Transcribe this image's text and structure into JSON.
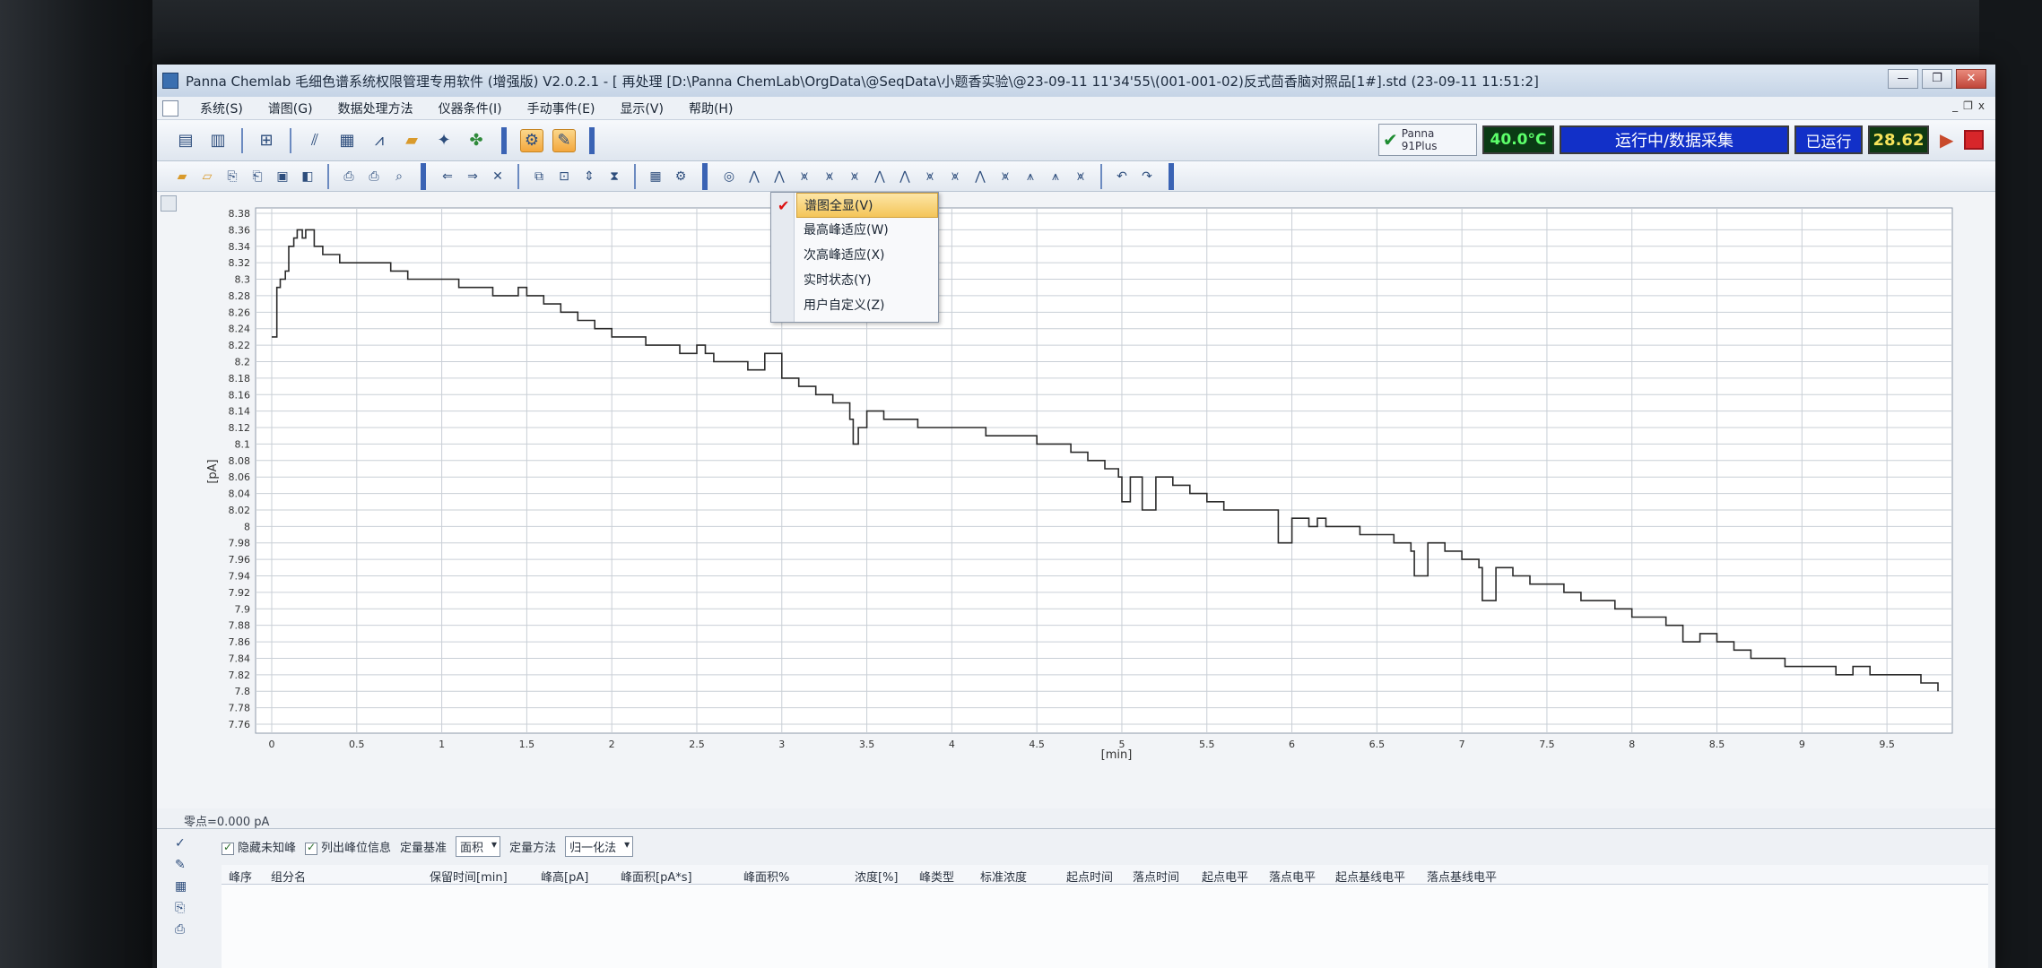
{
  "window": {
    "title": "Panna Chemlab 毛细色谱系统权限管理专用软件 (增强版) V2.0.2.1 - [ 再处理 [D:\\Panna ChemLab\\OrgData\\@SeqData\\小题香实验\\@23-09-11 11'34'55\\(001-001-02)反式茴香脑对照品[1#].std (23-09-11 11:51:2]",
    "buttons": {
      "minimize": "—",
      "restore": "❐",
      "close": "✕"
    }
  },
  "menubar": {
    "items": [
      "系统(S)",
      "谱图(G)",
      "数据处理方法",
      "仪器条件(I)",
      "手动事件(E)",
      "显示(V)",
      "帮助(H)"
    ],
    "mdi_buttons": [
      "_",
      "❐",
      "x"
    ]
  },
  "toolbar1": {
    "icons": [
      "method-icon",
      "report-icon",
      "grid-icon",
      "chart-icon",
      "table-icon",
      "compare-icon",
      "folder-icon",
      "network-icon",
      "tree-icon",
      "sequence-icon",
      "sample-icon"
    ]
  },
  "status": {
    "instrument_name": "Panna",
    "instrument_model": "91Plus",
    "temperature": "40.0°C",
    "run_state": "运行中/数据采集",
    "run_label": "已运行",
    "run_time": "28.62",
    "colors": {
      "temp_bg": "#0a3b14",
      "temp_fg": "#5cff6a",
      "state_bg": "#1230c8",
      "time_fg": "#f6e35a",
      "stop": "#d7262a"
    }
  },
  "dropdown": {
    "items": [
      {
        "label": "谱图全显(V)",
        "checked": true,
        "active": true
      },
      {
        "label": "最高峰适应(W)",
        "checked": false,
        "active": false
      },
      {
        "label": "次高峰适应(X)",
        "checked": false,
        "active": false
      },
      {
        "label": "实时状态(Y)",
        "checked": false,
        "active": false
      },
      {
        "label": "用户自定义(Z)",
        "checked": false,
        "active": false
      }
    ]
  },
  "chart_data": {
    "type": "line",
    "xlabel": "[min]",
    "ylabel": "[pA]",
    "xlim": [
      0,
      9.8
    ],
    "ylim": [
      7.76,
      8.38
    ],
    "x_ticks": [
      "0",
      "0.5",
      "1",
      "1.5",
      "2",
      "2.5",
      "3",
      "3.5",
      "4",
      "4.5",
      "5",
      "5.5",
      "6",
      "6.5",
      "7",
      "7.5",
      "8",
      "8.5",
      "9",
      "9.5"
    ],
    "y_ticks": [
      "8.38",
      "8.36",
      "8.34",
      "8.32",
      "8.3",
      "8.28",
      "8.26",
      "8.24",
      "8.22",
      "8.2",
      "8.18",
      "8.16",
      "8.14",
      "8.12",
      "8.1",
      "8.08",
      "8.06",
      "8.04",
      "8.02",
      "8",
      "7.98",
      "7.96",
      "7.94",
      "7.92",
      "7.9",
      "7.88",
      "7.86",
      "7.84",
      "7.82",
      "7.8",
      "7.78",
      "7.76"
    ],
    "grid": true,
    "series": [
      {
        "x": [
          0,
          0.03,
          0.05,
          0.08,
          0.1,
          0.13,
          0.15,
          0.18,
          0.2,
          0.25,
          0.3,
          0.35,
          0.4,
          0.5,
          0.6,
          0.7,
          0.8,
          0.9,
          1.0,
          1.1,
          1.2,
          1.3,
          1.4,
          1.45,
          1.5,
          1.6,
          1.7,
          1.8,
          1.9,
          2.0,
          2.1,
          2.2,
          2.3,
          2.4,
          2.5,
          2.55,
          2.6,
          2.7,
          2.8,
          2.9,
          3.0,
          3.1,
          3.2,
          3.3,
          3.4,
          3.42,
          3.45,
          3.5,
          3.6,
          3.7,
          3.8,
          3.9,
          4.0,
          4.1,
          4.2,
          4.3,
          4.4,
          4.5,
          4.6,
          4.7,
          4.8,
          4.9,
          4.98,
          5.0,
          5.05,
          5.1,
          5.12,
          5.2,
          5.3,
          5.4,
          5.5,
          5.6,
          5.7,
          5.8,
          5.9,
          5.92,
          6.0,
          6.1,
          6.15,
          6.2,
          6.3,
          6.4,
          6.5,
          6.6,
          6.7,
          6.72,
          6.8,
          6.9,
          7.0,
          7.1,
          7.12,
          7.2,
          7.3,
          7.4,
          7.5,
          7.6,
          7.7,
          7.8,
          7.9,
          8.0,
          8.1,
          8.2,
          8.3,
          8.4,
          8.5,
          8.6,
          8.7,
          8.8,
          8.9,
          9.0,
          9.1,
          9.2,
          9.3,
          9.4,
          9.5,
          9.6,
          9.7,
          9.8
        ],
        "y": [
          8.23,
          8.29,
          8.3,
          8.31,
          8.34,
          8.35,
          8.36,
          8.35,
          8.36,
          8.34,
          8.33,
          8.33,
          8.32,
          8.32,
          8.32,
          8.31,
          8.3,
          8.3,
          8.3,
          8.29,
          8.29,
          8.28,
          8.28,
          8.29,
          8.28,
          8.27,
          8.26,
          8.25,
          8.24,
          8.23,
          8.23,
          8.22,
          8.22,
          8.21,
          8.22,
          8.21,
          8.2,
          8.2,
          8.19,
          8.21,
          8.18,
          8.17,
          8.16,
          8.15,
          8.13,
          8.1,
          8.12,
          8.14,
          8.13,
          8.13,
          8.12,
          8.12,
          8.12,
          8.12,
          8.11,
          8.11,
          8.11,
          8.1,
          8.1,
          8.09,
          8.08,
          8.07,
          8.06,
          8.03,
          8.06,
          8.06,
          8.02,
          8.06,
          8.05,
          8.04,
          8.03,
          8.02,
          8.02,
          8.02,
          8.02,
          7.98,
          8.01,
          8.0,
          8.01,
          8.0,
          8.0,
          7.99,
          7.99,
          7.98,
          7.97,
          7.94,
          7.98,
          7.97,
          7.96,
          7.95,
          7.91,
          7.95,
          7.94,
          7.93,
          7.93,
          7.92,
          7.91,
          7.91,
          7.9,
          7.89,
          7.89,
          7.88,
          7.86,
          7.87,
          7.86,
          7.85,
          7.84,
          7.84,
          7.83,
          7.83,
          7.83,
          7.82,
          7.83,
          7.82,
          7.82,
          7.82,
          7.81,
          7.8
        ]
      }
    ]
  },
  "chart_footer": {
    "zero_label": "零点=0.000 pA"
  },
  "bottom_panel": {
    "checkbox1": "隐藏未知峰",
    "checkbox2": "列出峰位信息",
    "quant_basis_label": "定量基准",
    "quant_basis_value": "面积",
    "quant_method_label": "定量方法",
    "quant_method_value": "归一化法",
    "columns": [
      "峰序",
      "组分名",
      "保留时间[min]",
      "峰高[pA]",
      "峰面积[pA*s]",
      "峰面积%",
      "浓度[%]",
      "峰类型",
      "标准浓度",
      "起点时间",
      "落点时间",
      "起点电平",
      "落点电平",
      "起点基线电平",
      "落点基线电平"
    ]
  }
}
